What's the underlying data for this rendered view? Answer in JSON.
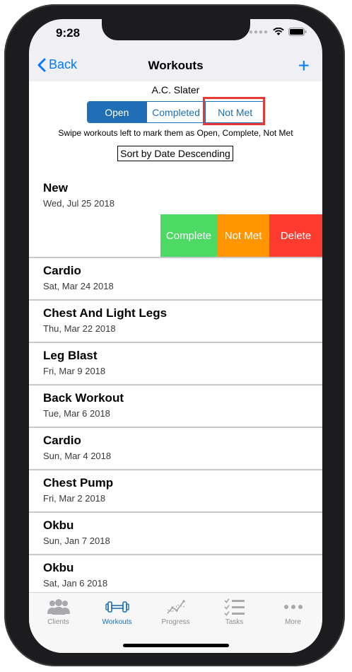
{
  "status_bar": {
    "time": "9:28"
  },
  "navbar": {
    "back_label": "Back",
    "title": "Workouts",
    "add_symbol": "+"
  },
  "client": {
    "name": "A.C. Slater"
  },
  "segments": [
    {
      "label": "Open",
      "active": true
    },
    {
      "label": "Completed",
      "active": false
    },
    {
      "label": "Not Met",
      "active": false
    }
  ],
  "hint": "Swipe workouts left to mark them as Open, Complete, Not Met",
  "sort_label": "Sort by Date Descending",
  "swipe_actions": [
    {
      "label": "Complete",
      "color": "#4cd964"
    },
    {
      "label": "Not Met",
      "color": "#ff9500"
    },
    {
      "label": "Delete",
      "color": "#ff3b30"
    }
  ],
  "workouts": [
    {
      "title": "New",
      "date": "Wed, Jul 25 2018"
    },
    {
      "title": "Cardio",
      "date": "Sat, Mar 24 2018"
    },
    {
      "title": "Chest And Light Legs",
      "date": "Thu, Mar 22 2018"
    },
    {
      "title": "Leg Blast",
      "date": "Fri, Mar 9 2018"
    },
    {
      "title": "Back Workout",
      "date": "Tue, Mar 6 2018"
    },
    {
      "title": "Cardio",
      "date": "Sun, Mar 4 2018"
    },
    {
      "title": "Chest Pump",
      "date": "Fri, Mar 2 2018"
    },
    {
      "title": "Okbu",
      "date": "Sun, Jan 7 2018"
    },
    {
      "title": "Okbu",
      "date": "Sat, Jan 6 2018"
    }
  ],
  "tabs": [
    {
      "label": "Clients",
      "icon": "clients-icon",
      "active": false
    },
    {
      "label": "Workouts",
      "icon": "dumbbell-icon",
      "active": true
    },
    {
      "label": "Progress",
      "icon": "progress-chart-icon",
      "active": false
    },
    {
      "label": "Tasks",
      "icon": "tasks-checklist-icon",
      "active": false
    },
    {
      "label": "More",
      "icon": "more-dots-icon",
      "active": false
    }
  ],
  "colors": {
    "accent": "#1e6fb5",
    "ios_blue": "#007aff",
    "highlight_red": "#e53935"
  }
}
